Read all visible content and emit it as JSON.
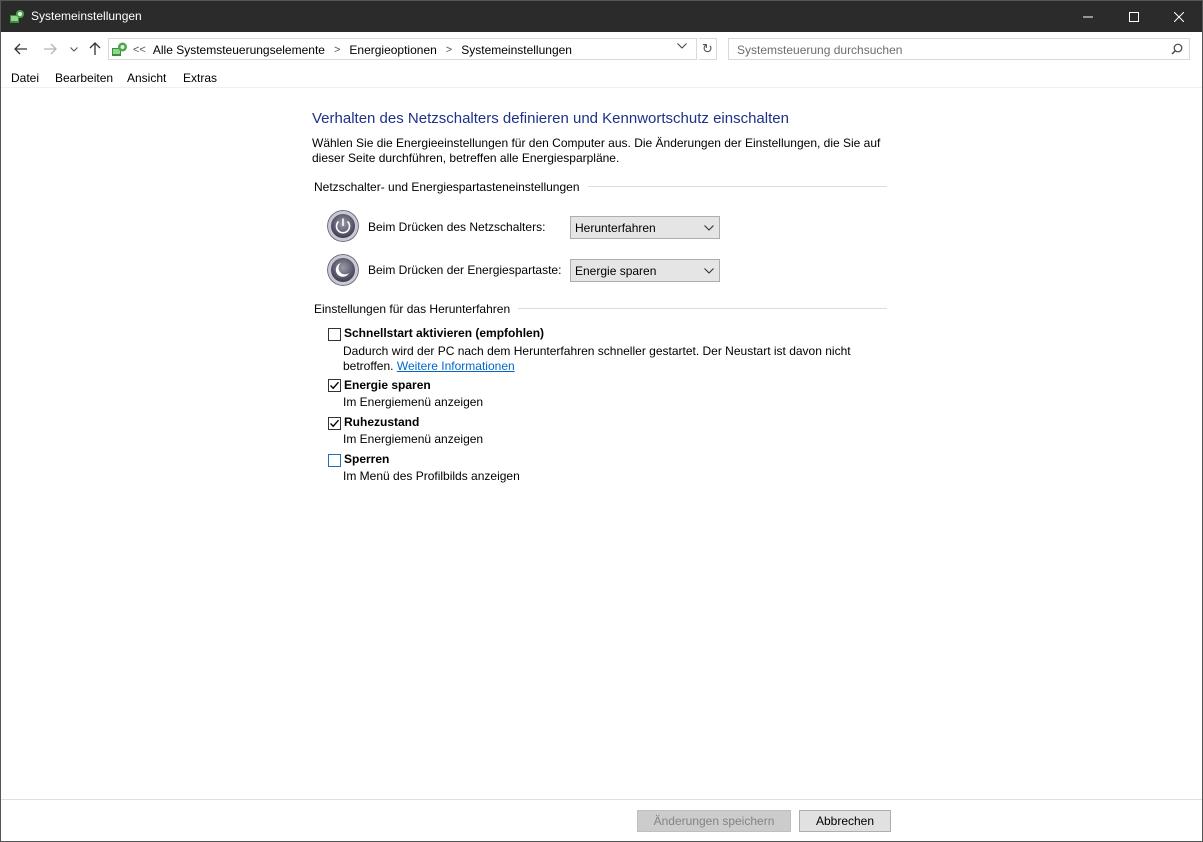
{
  "window": {
    "title": "Systemeinstellungen"
  },
  "address": {
    "lead": "<<",
    "crumbs": [
      "Alle Systemsteuerungselemente",
      "Energieoptionen",
      "Systemeinstellungen"
    ],
    "separator": ">"
  },
  "search": {
    "placeholder": "Systemsteuerung durchsuchen"
  },
  "menu": {
    "items": [
      "Datei",
      "Bearbeiten",
      "Ansicht",
      "Extras"
    ]
  },
  "main": {
    "heading": "Verhalten des Netzschalters definieren und Kennwortschutz einschalten",
    "description": "Wählen Sie die Energieeinstellungen für den Computer aus. Die Änderungen der Einstellungen, die Sie auf dieser Seite durchführen, betreffen alle Energiesparpläne.",
    "power_section": {
      "title": "Netzschalter- und Energiespartasteneinstellungen",
      "power_button": {
        "label": "Beim Drücken des Netzschalters:",
        "value": "Herunterfahren"
      },
      "sleep_button": {
        "label": "Beim Drücken der Energiespartaste:",
        "value": "Energie sparen"
      }
    },
    "shutdown_section": {
      "title": "Einstellungen für das Herunterfahren",
      "fast_startup": {
        "label": "Schnellstart aktivieren (empfohlen)",
        "checked": false,
        "desc_line1": "Dadurch wird der PC nach dem Herunterfahren schneller gestartet. Der Neustart ist davon nicht",
        "desc_line2": "betroffen.",
        "link": "Weitere Informationen"
      },
      "sleep": {
        "label": "Energie sparen",
        "checked": true,
        "desc": "Im Energiemenü anzeigen"
      },
      "hibernate": {
        "label": "Ruhezustand",
        "checked": true,
        "desc": "Im Energiemenü anzeigen"
      },
      "lock": {
        "label": "Sperren",
        "checked": false,
        "desc": "Im Menü des Profilbilds anzeigen"
      }
    }
  },
  "footer": {
    "save_label": "Änderungen speichern",
    "cancel_label": "Abbrechen"
  },
  "colors": {
    "titlebar": "#2b2b2b",
    "heading": "#1e3287",
    "link": "#0066cc"
  }
}
